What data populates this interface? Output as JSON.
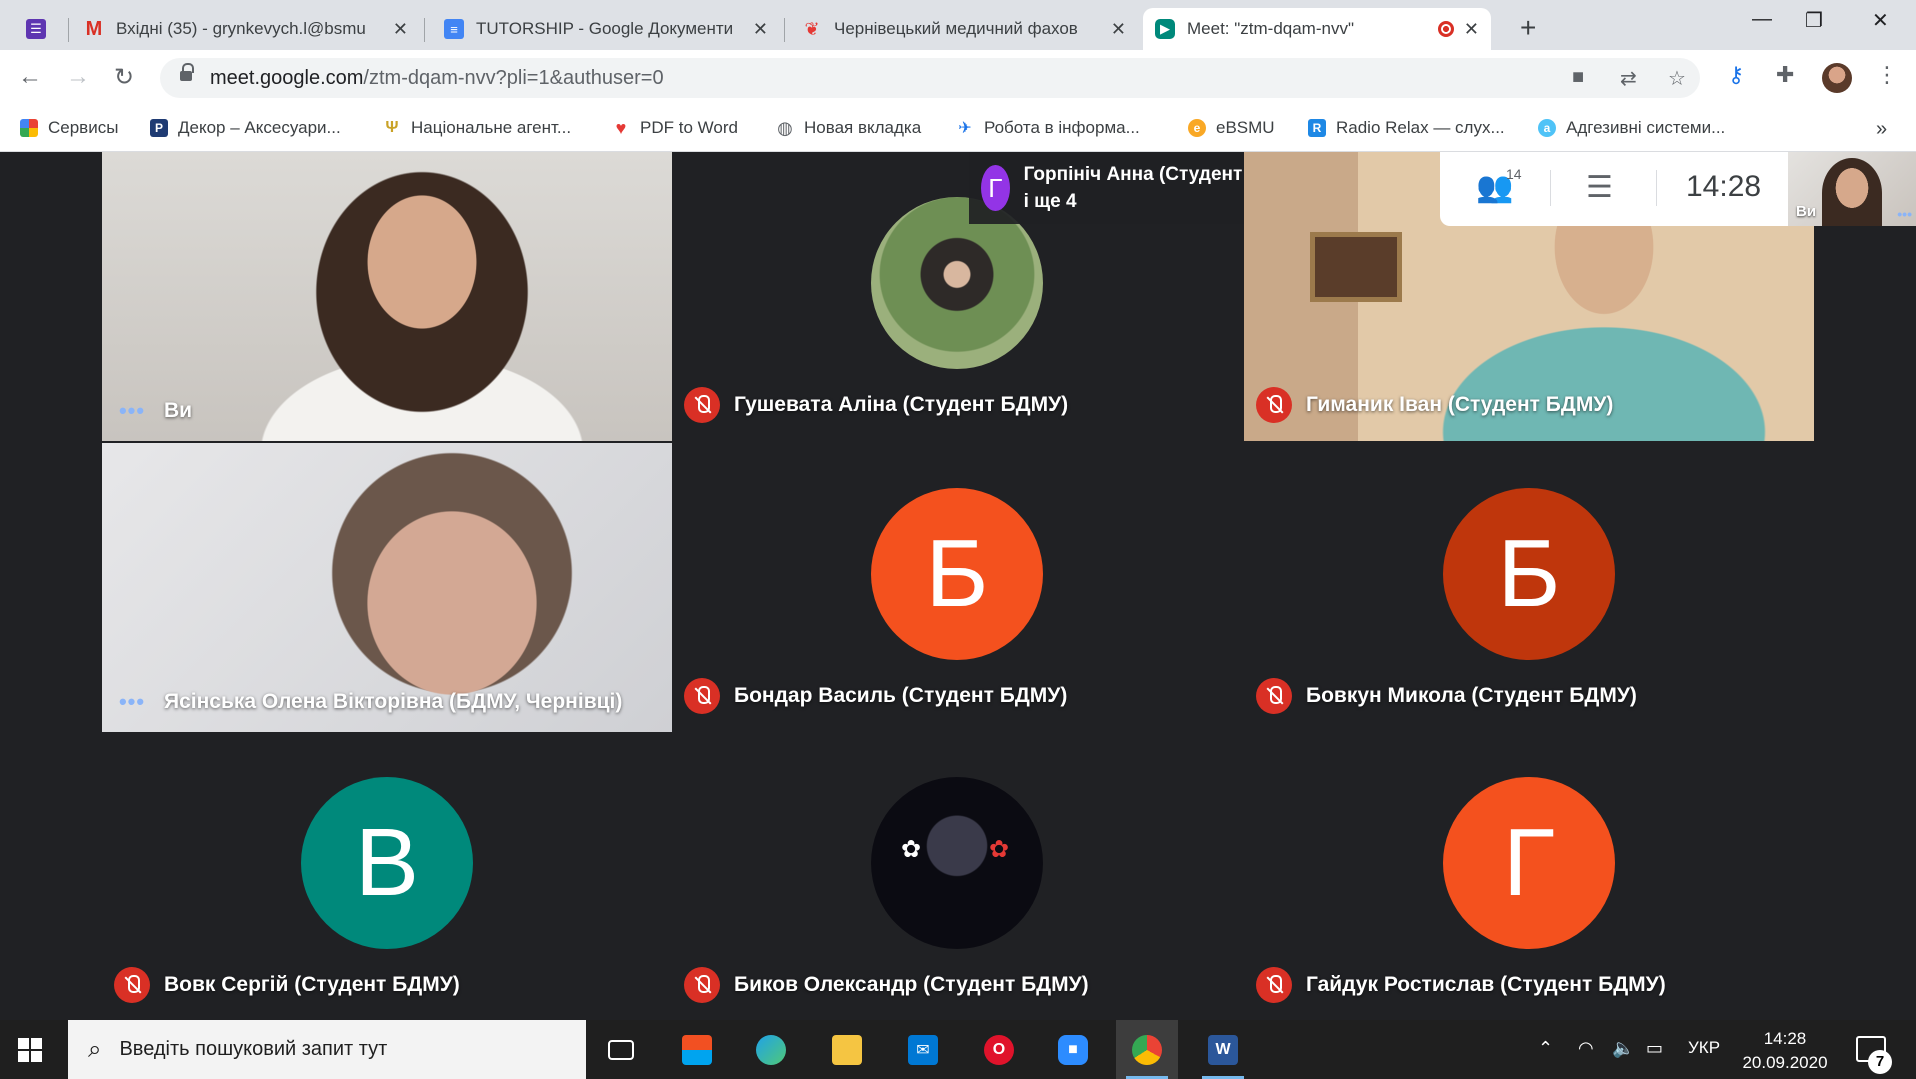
{
  "tabs": [
    {
      "title": "Вхідні (35) - grynkevych.l@bsmu",
      "icon": "gmail-icon"
    },
    {
      "title": "TUTORSHIP - Google Документи",
      "icon": "google-docs-icon"
    },
    {
      "title": "Чернівецький медичний фахов",
      "icon": "college-icon"
    },
    {
      "title": "Meet: \"ztm-dqam-nvv\"",
      "icon": "meet-icon"
    }
  ],
  "address_bar": {
    "host": "meet.google.com",
    "path": "/ztm-dqam-nvv?pli=1&authuser=0"
  },
  "bookmarks": [
    {
      "label": "Сервисы",
      "icon": "apps-grid-icon"
    },
    {
      "label": "Декор – Аксесуари...",
      "icon": "decor-icon"
    },
    {
      "label": "Національне агент...",
      "icon": "trident-icon"
    },
    {
      "label": "PDF to Word",
      "icon": "heart-icon"
    },
    {
      "label": "Новая вкладка",
      "icon": "globe-icon"
    },
    {
      "label": "Робота в інформа...",
      "icon": "bird-icon"
    },
    {
      "label": "eBSMU",
      "icon": "ebsmu-icon"
    },
    {
      "label": "Radio Relax — слух...",
      "icon": "radio-icon"
    },
    {
      "label": "Адгезивні системи...",
      "icon": "letter-a-icon"
    }
  ],
  "meet": {
    "speaker": {
      "initial": "Г",
      "name": "Горпініч Анна (Студент БДМУ) ... БД...",
      "extra": "і ще 4"
    },
    "participants_count": "14",
    "time": "14:28",
    "self_label": "Ви",
    "tiles": [
      {
        "name": "Ви",
        "status": "speaking"
      },
      {
        "name": "Гушевата Аліна (Студент БДМУ)",
        "status": "muted"
      },
      {
        "name": "Гиманик Іван (Студент БДМУ)",
        "status": "muted"
      },
      {
        "name": "Ясінська Олена Вікторівна (БДМУ, Чернівці)",
        "status": "speaking"
      },
      {
        "name": "Бондар Василь (Студент БДМУ)",
        "status": "muted",
        "initial": "Б",
        "color": "#f4511e"
      },
      {
        "name": "Бовкун Микола (Студент БДМУ)",
        "status": "muted",
        "initial": "Б",
        "color": "#bf360c"
      },
      {
        "name": "Вовк Сергій (Студент БДМУ)",
        "status": "muted",
        "initial": "В",
        "color": "#00897b"
      },
      {
        "name": "Биков Олександр (Студент БДМУ)",
        "status": "muted"
      },
      {
        "name": "Гайдук Ростислав (Студент БДМУ)",
        "status": "muted",
        "initial": "Г",
        "color": "#f4511e"
      }
    ]
  },
  "taskbar": {
    "search_placeholder": "Введіть пошуковий запит тут",
    "language": "УКР",
    "time": "14:28",
    "date": "20.09.2020",
    "notifications": "7"
  }
}
